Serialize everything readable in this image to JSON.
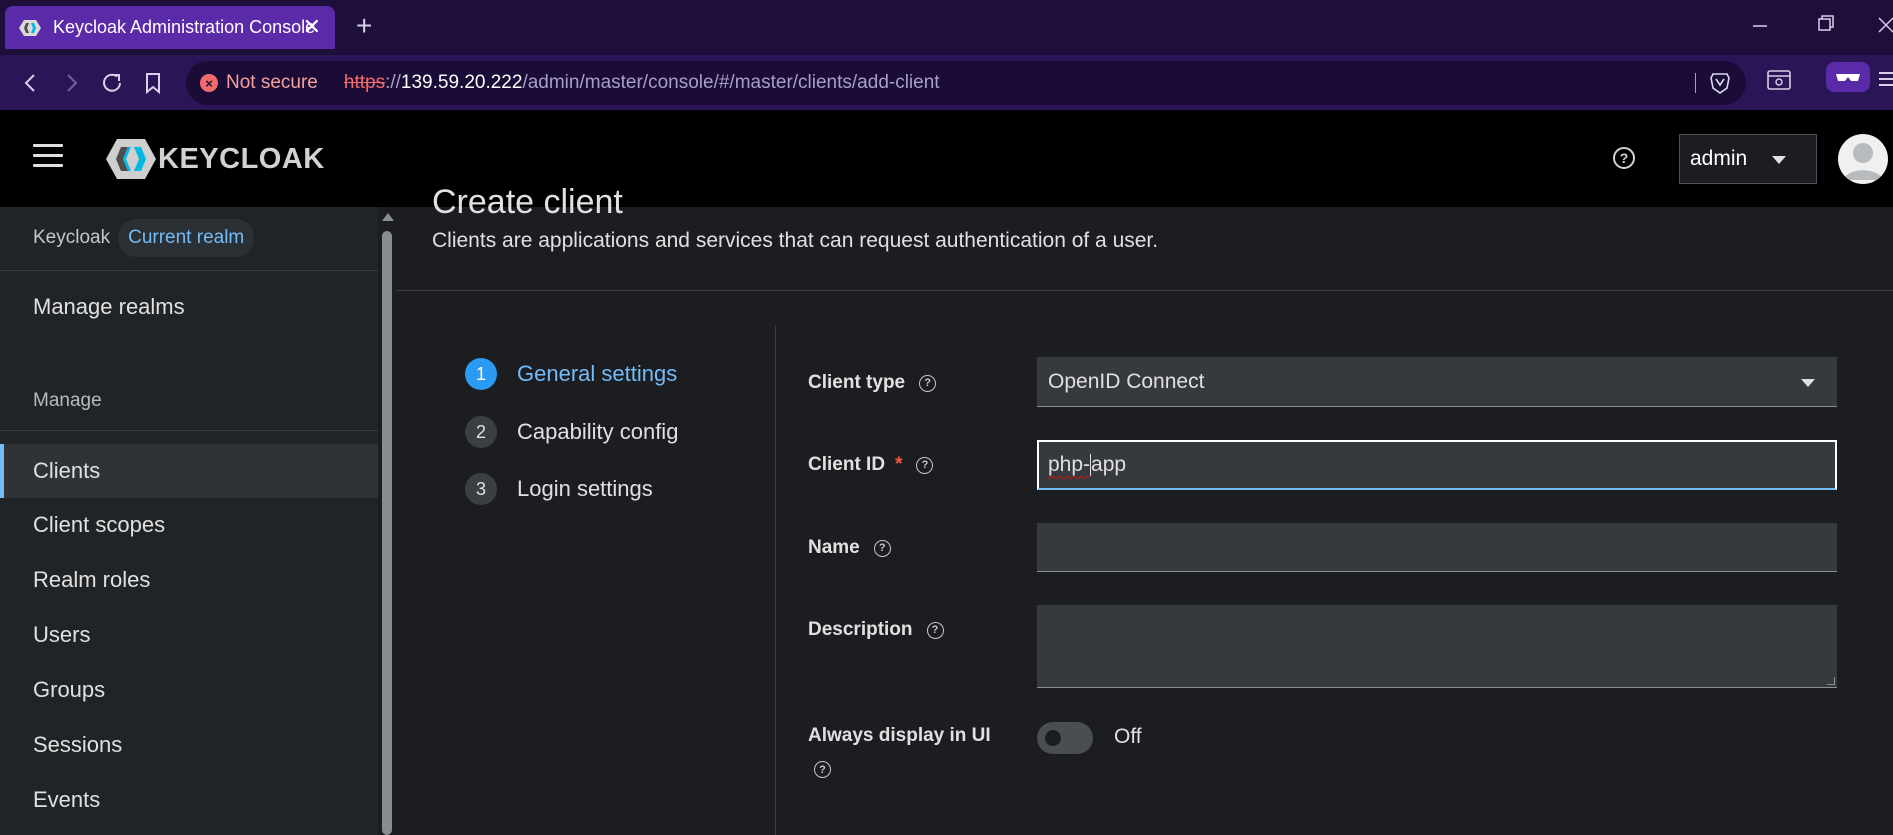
{
  "browser": {
    "tab_title": "Keycloak Administration Console",
    "tab_close": "✕",
    "new_tab": "+",
    "not_secure": "Not secure",
    "url_scheme": "https",
    "url_sep": "://",
    "url_host": "139.59.20.222",
    "url_path": "/admin/master/console/#/master/clients/add-client"
  },
  "header": {
    "logo_text": "KEYCLOAK",
    "help": "?",
    "user": "admin"
  },
  "sidebar": {
    "realm_name": "Keycloak",
    "realm_badge": "Current realm",
    "manage_realms": "Manage realms",
    "section": "Manage",
    "items": [
      {
        "label": "Clients"
      },
      {
        "label": "Client scopes"
      },
      {
        "label": "Realm roles"
      },
      {
        "label": "Users"
      },
      {
        "label": "Groups"
      },
      {
        "label": "Sessions"
      },
      {
        "label": "Events"
      }
    ]
  },
  "page": {
    "title": "Create client",
    "description": "Clients are applications and services that can request authentication of a user."
  },
  "wizard": {
    "steps": [
      {
        "num": "1",
        "label": "General settings"
      },
      {
        "num": "2",
        "label": "Capability config"
      },
      {
        "num": "3",
        "label": "Login settings"
      }
    ]
  },
  "form": {
    "client_type_label": "Client type",
    "client_type_value": "OpenID Connect",
    "client_id_label": "Client ID",
    "client_id_required": "*",
    "client_id_value_a": "php-",
    "client_id_value_b": "app",
    "name_label": "Name",
    "name_value": "",
    "description_label": "Description",
    "description_value": "",
    "always_display_label": "Always display in UI",
    "always_display_state": "Off",
    "help_glyph": "?"
  }
}
